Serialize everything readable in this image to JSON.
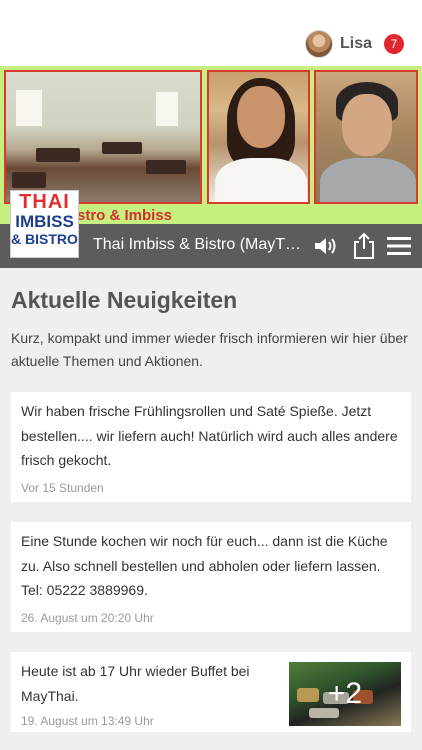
{
  "user": {
    "name": "Lisa",
    "notification_count": "7"
  },
  "header": {
    "banner_text": "Bistro & Imbiss",
    "logo": {
      "line1": "THAI",
      "line2": "IMBISS",
      "line3": "& BISTRO"
    }
  },
  "titlebar": {
    "title": "Thai Imbiss & Bistro (MayThai)",
    "icons": [
      "speaker-icon",
      "share-icon",
      "menu-icon"
    ]
  },
  "main": {
    "heading": "Aktuelle Neuigkeiten",
    "intro": "Kurz, kompakt und immer wieder frisch informieren wir hier über aktuelle Themen und Aktionen.",
    "posts": [
      {
        "text": "Wir haben frische Frühlingsrollen und Saté Spieße. Jetzt bestellen.... wir liefern auch! Natürlich wird auch alles andere frisch gekocht.",
        "time": "Vor 15 Stunden"
      },
      {
        "text": "Eine Stunde kochen wir noch für euch... dann ist die Küche zu. Also schnell bestellen und abholen oder liefern lassen. Tel: 05222 3889969.",
        "time": "26. August um 20:20 Uhr"
      },
      {
        "text": "Heute ist ab 17 Uhr wieder Buffet bei MayThai.",
        "time": "19. August um 13:49 Uhr",
        "image_more": "+2"
      }
    ]
  },
  "colors": {
    "banner_green": "#c5ef7e",
    "title_bar": "#5c5c5c",
    "badge_red": "#e0262e",
    "logo_red": "#e12f2f",
    "logo_blue": "#1d3f8e"
  }
}
